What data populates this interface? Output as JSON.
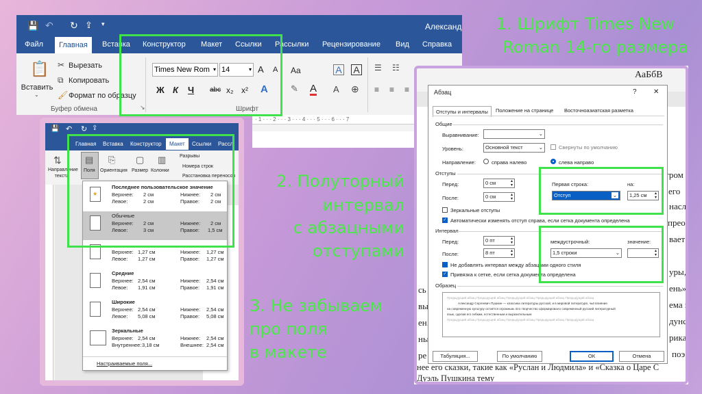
{
  "annotations": {
    "a1_line1": "1. Шрифт Times New",
    "a1_line2": "Roman 14-го размера",
    "a2_line1": "2. Полуторный",
    "a2_line2": "интервал",
    "a2_line3": "с абзацными",
    "a2_line4": "отступами",
    "a3_line1": "3. Не забываем",
    "a3_line2": "про поля",
    "a3_line3": "в макете"
  },
  "word_main": {
    "user": "Александр",
    "tabs": [
      "Файл",
      "Главная",
      "Вставка",
      "Конструктор",
      "Макет",
      "Ссылки",
      "Рассылки",
      "Рецензирование",
      "Вид",
      "Справка"
    ],
    "active_tab": "Главная",
    "paste_label": "Вставить",
    "cut_label": "Вырезать",
    "copy_label": "Копировать",
    "format_painter_label": "Формат по образцу",
    "clipboard_group": "Буфер обмена",
    "font_name": "Times New Rom",
    "font_size": "14",
    "font_group": "Шрифт",
    "bold": "Ж",
    "italic": "К",
    "underline": "Ч",
    "strike": "abc",
    "sub": "x₂",
    "sup": "x²",
    "grow": "A",
    "shrink": "A",
    "case": "Aa",
    "styles_preview": "АаБбВ"
  },
  "word_layout": {
    "tabs": [
      "Главная",
      "Вставка",
      "Конструктор",
      "Макет",
      "Ссылки",
      "Рассл"
    ],
    "active_tab": "Макет",
    "direction_label": "Направление текста",
    "margins_label": "Поля",
    "orientation_label": "Ориентация",
    "size_label": "Размер",
    "columns_label": "Колонки",
    "breaks_label": "Разрывы",
    "line_numbers_label": "Номера строк",
    "hyphenation_label": "Расстановка переносов",
    "margins_menu": [
      {
        "title": "Последнее пользовательское значение",
        "l1": "Верхнее:",
        "v1": "2 см",
        "l2": "Нижнее:",
        "v2": "2 см",
        "l3": "Левое:",
        "v3": "2 см",
        "l4": "Правое:",
        "v4": "2 см"
      },
      {
        "title": "Обычные",
        "l1": "Верхнее:",
        "v1": "2 см",
        "l2": "Нижнее:",
        "v2": "2 см",
        "l3": "Левое:",
        "v3": "3 см",
        "l4": "Правое:",
        "v4": "1,5 см"
      },
      {
        "title": "",
        "l1": "Верхнее:",
        "v1": "1,27 см",
        "l2": "Нижнее:",
        "v2": "1,27 см",
        "l3": "Левое:",
        "v3": "1,27 см",
        "l4": "Правое:",
        "v4": "1,27 см"
      },
      {
        "title": "Средние",
        "l1": "Верхнее:",
        "v1": "2,54 см",
        "l2": "Нижнее:",
        "v2": "2,54 см",
        "l3": "Левое:",
        "v3": "1,91 см",
        "l4": "Правое:",
        "v4": "1,91 см"
      },
      {
        "title": "Широкие",
        "l1": "Верхнее:",
        "v1": "2,54 см",
        "l2": "Нижнее:",
        "v2": "2,54 см",
        "l3": "Левое:",
        "v3": "5,08 см",
        "l4": "Правое:",
        "v4": "5,08 см"
      },
      {
        "title": "Зеркальные",
        "l1": "Верхнее:",
        "v1": "2,54 см",
        "l2": "Нижнее:",
        "v2": "2,54 см",
        "l3": "Внутреннее:",
        "v3": "3,18 см",
        "l4": "Внешнее:",
        "v4": "2,54 см"
      }
    ],
    "custom_margins": "Настраиваемые поля..."
  },
  "dialog": {
    "title": "Абзац",
    "help": "?",
    "close": "✕",
    "tabs": [
      "Отступы и интервалы",
      "Положение на странице",
      "Восточноазиатская разметка"
    ],
    "general_section": "Общие",
    "alignment_label": "Выравнивание:",
    "alignment_value": "",
    "level_label": "Уровень:",
    "level_value": "Основной текст",
    "collapsed_label": "Свернуты по умолчанию",
    "direction_label": "Направление:",
    "rtl_label": "справа налево",
    "ltr_label": "слева направо",
    "indents_section": "Отступы",
    "before_label": "Перед:",
    "before_value": "0 см",
    "after_label": "После:",
    "after_value": "0 см",
    "first_line_label": "Первая строка:",
    "first_line_value": "Отступ",
    "on_label": "на:",
    "on_value": "1,25 см",
    "mirror_label": "Зеркальные отступы",
    "auto_label": "Автоматически изменять отступ справа, если сетка документа определена",
    "interval_section": "Интервал",
    "sp_before_label": "Перед:",
    "sp_before_value": "0 пт",
    "sp_after_label": "После:",
    "sp_after_value": "8 пт",
    "line_label": "междустрочный:",
    "line_value": "1,5 строки",
    "value_label": "значение:",
    "value_value": "",
    "no_space_label": "Не добавлять интервал между абзацами одного стиля",
    "snap_label": "Привязка к сетке, если сетка документа определена",
    "sample_section": "Образец",
    "sample_grey": "Предыдущий абзац Предыдущий абзац Предыдущий абзац Предыдущий абзац Предыдущий абзац",
    "sample_text1": "Александр Сергеевич Пушкин — классика литературы русской, и в мировой литературе, чьё влияние",
    "sample_text2": "на современную культуру остаётся огромным. Его творчество сформировало современный русский литературный",
    "sample_text3": "язык, сделав его гибким, естественным и выразительным",
    "tabs_btn": "Табуляция...",
    "default_btn": "По умолчанию",
    "ok_btn": "ОК",
    "cancel_btn": "Отмена"
  },
  "doc_bg": {
    "frag1": "тром",
    "frag2": "ая его",
    "frag3": "насль",
    "frag4": "преоб",
    "frag5": "вает",
    "frag6": "уры,",
    "frag7": "ень»",
    "frag8": "ема и",
    "frag9": "дунс",
    "frag10": "рика,",
    "frag11": "поэ",
    "bottom1": "нее его сказки, такие как «Руслан и Людмила» и «Сказка о Царе С",
    "bottom2": "Дуэль Пушкина тему",
    "side1": "сь",
    "side2": "вы.",
    "side3": "ен.",
    "side4": "ны",
    "side5": "ре"
  }
}
